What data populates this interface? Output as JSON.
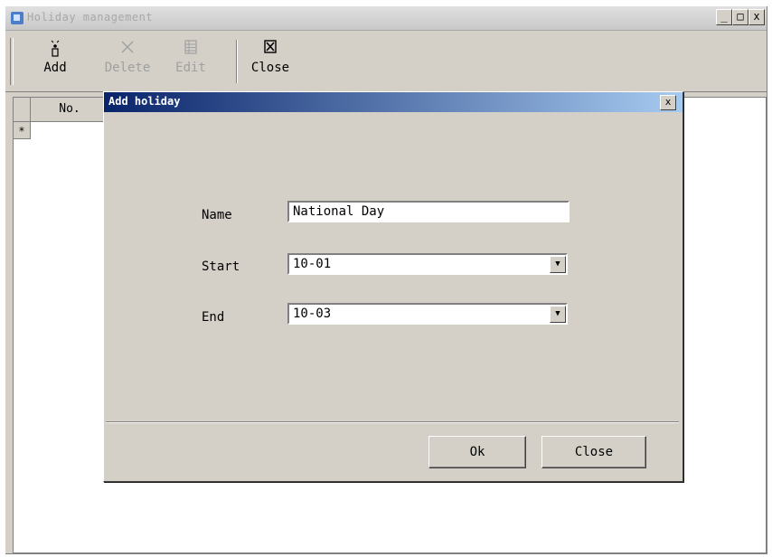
{
  "window": {
    "title": "Holiday management",
    "minimize_label": "_",
    "maximize_label": "□",
    "close_label": "x"
  },
  "toolbar": {
    "add": {
      "label": "Add",
      "icon": "add-user-icon"
    },
    "delete": {
      "label": "Delete",
      "icon": "delete-x-icon",
      "disabled": true
    },
    "edit": {
      "label": "Edit",
      "icon": "edit-grid-icon",
      "disabled": true
    },
    "close": {
      "label": "Close",
      "icon": "close-box-icon"
    }
  },
  "grid": {
    "columns": [
      "No."
    ],
    "new_row_marker": "*"
  },
  "dialog": {
    "title": "Add holiday",
    "close_label": "x",
    "name_label": "Name",
    "name_value": "National Day",
    "start_label": "Start",
    "start_value": "10-01",
    "end_label": "End",
    "end_value": "10-03",
    "ok_label": "Ok",
    "close_button_label": "Close"
  },
  "colors": {
    "face": "#d4d0c8",
    "dialog_title_start": "#0a246a",
    "dialog_title_end": "#a6caf0"
  }
}
